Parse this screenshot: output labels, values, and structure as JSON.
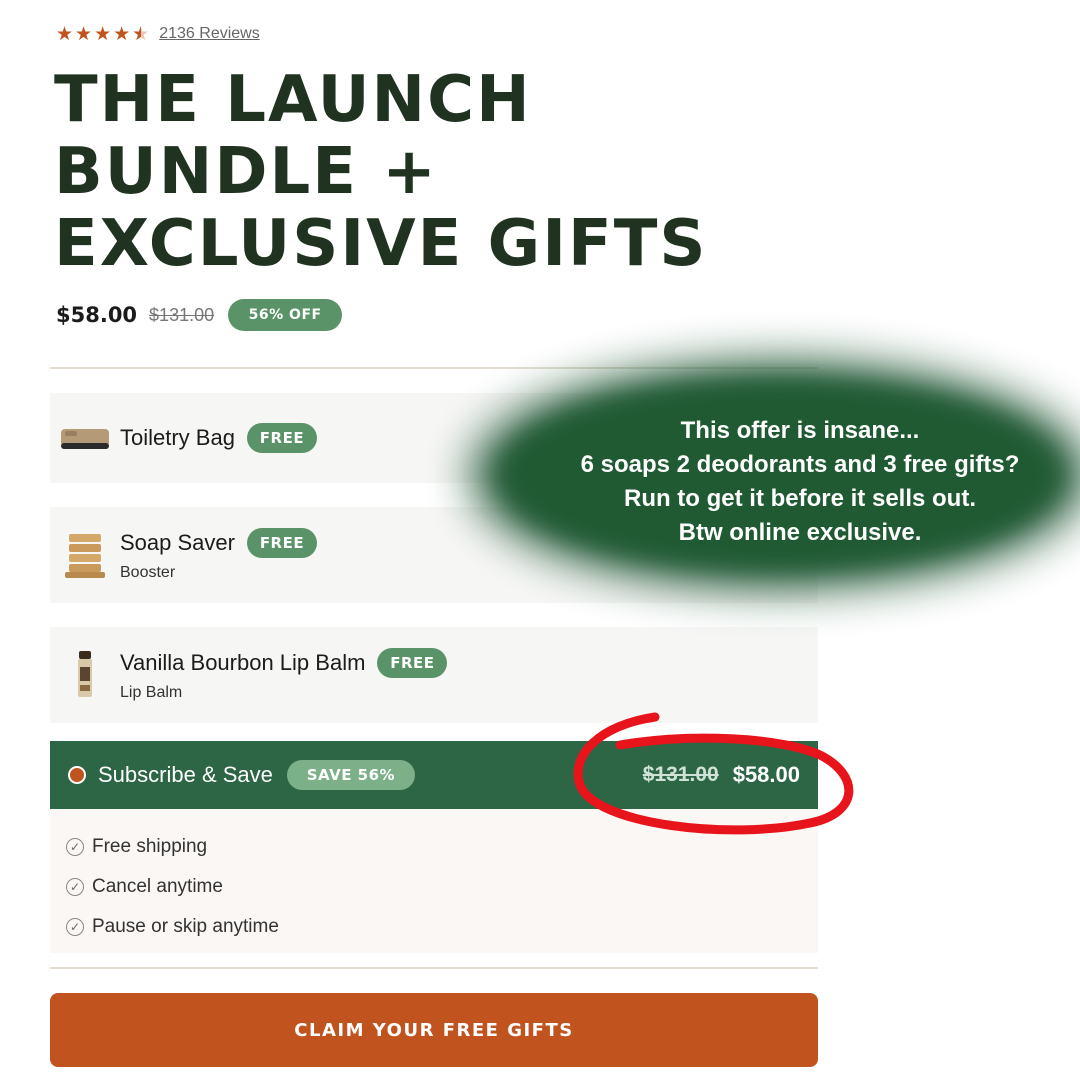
{
  "rating": {
    "stars": 4.5,
    "reviews_text": "2136 Reviews"
  },
  "title_lines": [
    "THE LAUNCH",
    "BUNDLE +",
    "EXCLUSIVE GIFTS"
  ],
  "price": {
    "current": "$58.00",
    "original": "$131.00",
    "badge": "56% OFF"
  },
  "gifts": [
    {
      "name": "Toiletry Bag",
      "badge": "FREE",
      "subtitle": "",
      "icon": "toiletry-bag-icon"
    },
    {
      "name": "Soap Saver",
      "badge": "FREE",
      "subtitle": "Booster",
      "icon": "soap-saver-icon"
    },
    {
      "name": "Vanilla Bourbon Lip Balm",
      "badge": "FREE",
      "subtitle": "Lip Balm",
      "icon": "lip-balm-icon"
    }
  ],
  "subscribe": {
    "label": "Subscribe & Save",
    "badge": "SAVE 56%",
    "original_price": "$131.00",
    "price": "$58.00",
    "benefits": [
      "Free shipping",
      "Cancel anytime",
      "Pause or skip anytime"
    ]
  },
  "cta_label": "CLAIM YOUR FREE GIFTS",
  "overlay_lines": [
    "This offer is insane...",
    "6 soaps 2 deodorants and 3 free gifts?",
    "Run to get it before it sells out.",
    "Btw online exclusive."
  ],
  "colors": {
    "brand_green": "#2c6645",
    "badge_green": "#5b9368",
    "accent_orange": "#c1531f",
    "annotation_red": "#e8141c"
  }
}
